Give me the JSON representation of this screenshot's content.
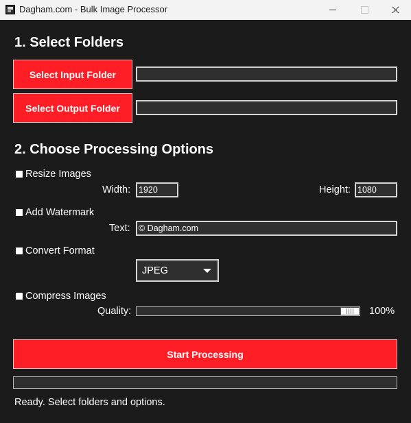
{
  "window": {
    "title": "Dagham.com - Bulk Image Processor",
    "controls": [
      "minimize",
      "maximize",
      "close"
    ]
  },
  "section_folders": {
    "heading": "1. Select Folders",
    "input_button": "Select Input Folder",
    "input_path": "",
    "output_button": "Select Output Folder",
    "output_path": ""
  },
  "section_options": {
    "heading": "2. Choose Processing Options",
    "resize": {
      "label": "Resize Images",
      "checked": false,
      "width_label": "Width:",
      "width_value": "1920",
      "height_label": "Height:",
      "height_value": "1080"
    },
    "watermark": {
      "label": "Add Watermark",
      "checked": false,
      "text_label": "Text:",
      "text_value": "© Dagham.com"
    },
    "convert": {
      "label": "Convert Format",
      "checked": false,
      "format_value": "JPEG"
    },
    "compress": {
      "label": "Compress Images",
      "checked": false,
      "quality_label": "Quality:",
      "quality_value": 100,
      "quality_text": "100%"
    }
  },
  "actions": {
    "start_button": "Start Processing"
  },
  "progress": {
    "value": 0
  },
  "status": {
    "text": "Ready. Select folders and options."
  },
  "colors": {
    "accent": "#ff1e26",
    "background": "#1b1b1b",
    "field_background": "#2f2f2f"
  },
  "icons": {
    "app": "app-icon",
    "dropdown": "chevron-down-icon"
  }
}
